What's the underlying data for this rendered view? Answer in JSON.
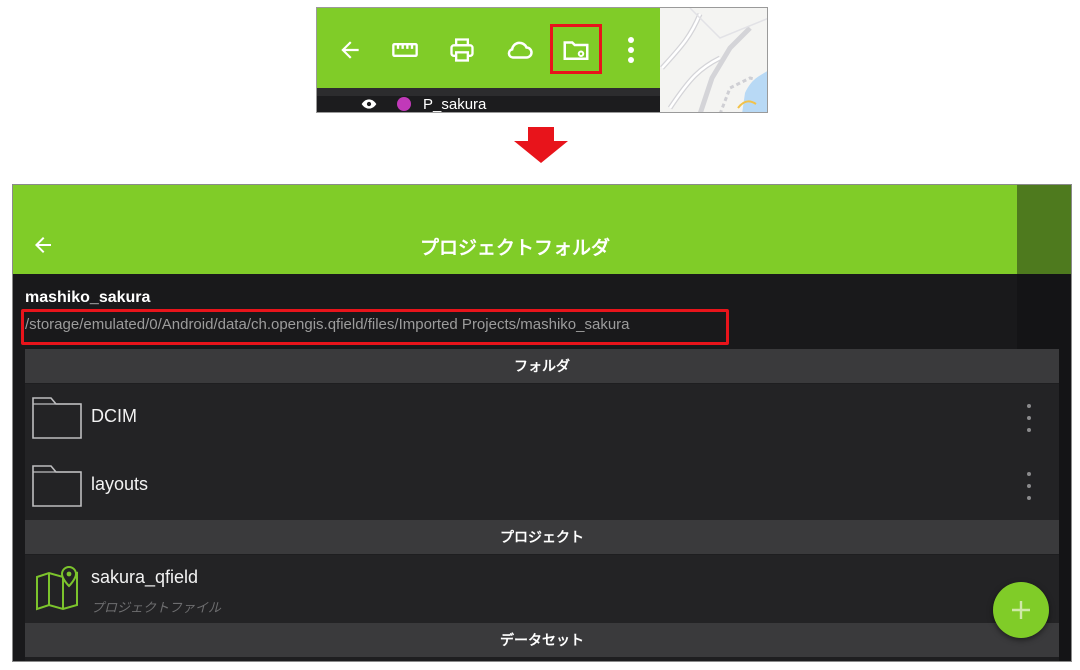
{
  "toolbar_crop": {
    "icons": [
      "back-arrow-icon",
      "ruler-icon",
      "printer-icon",
      "cloud-icon",
      "folder-gear-icon",
      "more-vertical-icon"
    ],
    "highlighted_icon": "folder-gear-icon",
    "layer": {
      "name": "P_sakura",
      "visibility_icon": "eye-icon",
      "color": "#c139b9"
    }
  },
  "arrow": {
    "color": "#e8141b",
    "icon": "down-arrow-icon"
  },
  "app": {
    "header": {
      "title": "プロジェクトフォルダ",
      "back_icon": "back-arrow-icon"
    },
    "project": {
      "name": "mashiko_sakura",
      "path": "/storage/emulated/0/Android/data/ch.opengis.qfield/files/Imported Projects/mashiko_sakura"
    },
    "sections": {
      "folders": {
        "title": "フォルダ",
        "items": [
          {
            "label": "DCIM",
            "icon": "folder-icon"
          },
          {
            "label": "layouts",
            "icon": "folder-icon"
          }
        ]
      },
      "projects": {
        "title": "プロジェクト",
        "items": [
          {
            "label": "sakura_qfield",
            "sublabel": "プロジェクトファイル",
            "icon": "map-pin-icon"
          }
        ]
      },
      "datasets": {
        "title": "データセット"
      }
    },
    "fab": {
      "icon": "plus-icon"
    }
  },
  "colors": {
    "accent": "#80cc28",
    "highlight": "#e8141b",
    "background": "#19191b"
  }
}
